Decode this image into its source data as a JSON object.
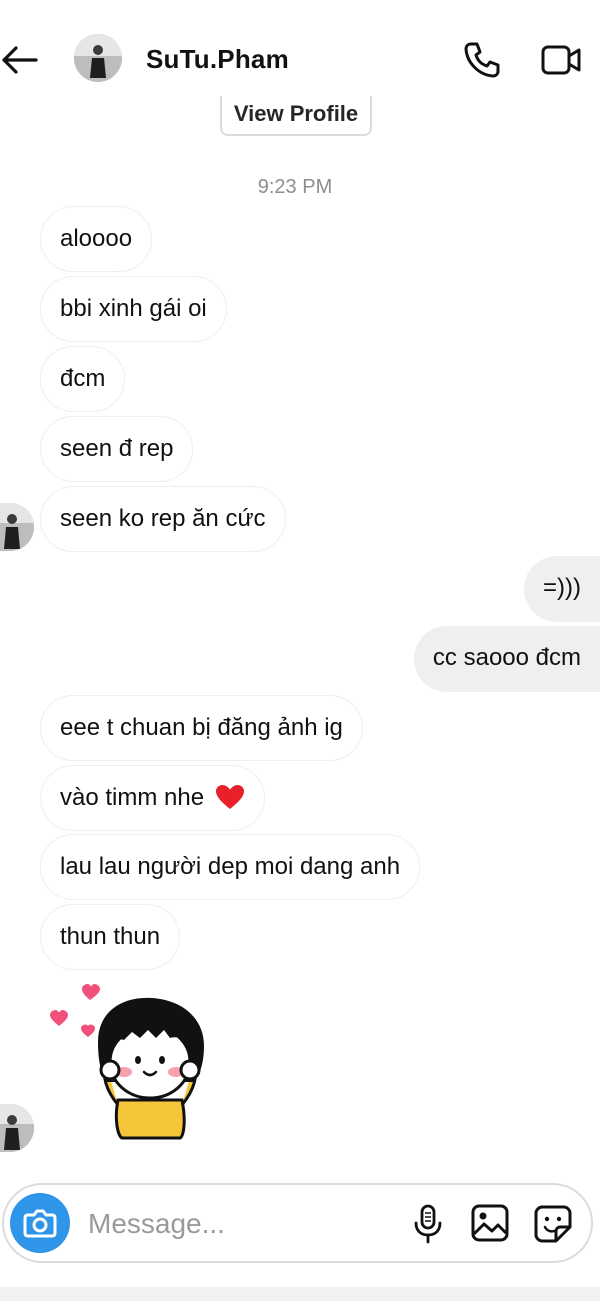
{
  "header": {
    "username": "SuTu.Pham",
    "back_icon": "arrow-left-icon",
    "call_icon": "phone-icon",
    "video_icon": "video-camera-icon"
  },
  "view_profile_label": "View Profile",
  "timestamp": "9:23 PM",
  "messages": [
    {
      "from": "them",
      "text": "aloooo"
    },
    {
      "from": "them",
      "text": "bbi xinh gái oi"
    },
    {
      "from": "them",
      "text": "đcm"
    },
    {
      "from": "them",
      "text": "seen đ rep"
    },
    {
      "from": "them",
      "text": "seen ko rep ăn cức"
    },
    {
      "from": "me",
      "text": "=)))"
    },
    {
      "from": "me",
      "text": "cc saooo đcm"
    },
    {
      "from": "them",
      "text": "eee t chuan bị đăng ảnh ig"
    },
    {
      "from": "them",
      "text": "vào timm nhe",
      "emoji": "red-heart-icon"
    },
    {
      "from": "them",
      "text": "lau lau người dep moi dang anh"
    },
    {
      "from": "them",
      "text": "thun thun"
    },
    {
      "from": "them",
      "sticker": "girl-with-hearts-sticker"
    }
  ],
  "composer": {
    "placeholder": "Message...",
    "camera_icon": "camera-icon",
    "mic_icon": "microphone-icon",
    "gallery_icon": "image-icon",
    "sticker_icon": "sticker-icon"
  },
  "colors": {
    "camera_button": "#2f95e8",
    "outgoing_bubble": "#efefef",
    "incoming_border": "#efefef",
    "timestamp": "#8e8e8e",
    "heart": "#e8202a"
  }
}
